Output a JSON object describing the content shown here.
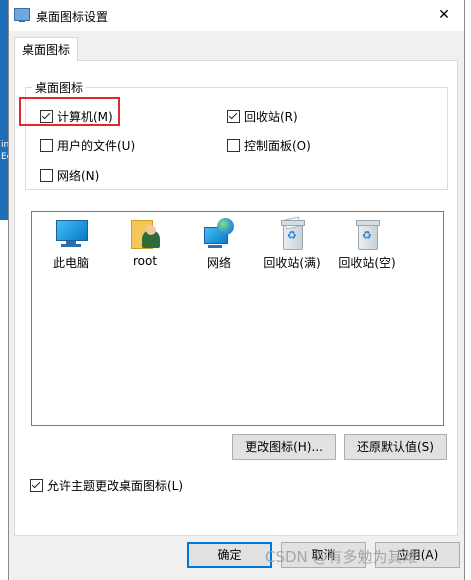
{
  "window": {
    "title": "桌面图标设置",
    "close_glyph": "✕"
  },
  "tabs": [
    {
      "label": "桌面图标"
    }
  ],
  "group": {
    "legend": "桌面图标",
    "checkboxes": [
      {
        "label": "计算机(M)",
        "checked": true
      },
      {
        "label": "回收站(R)",
        "checked": true
      },
      {
        "label": "用户的文件(U)",
        "checked": false
      },
      {
        "label": "控制面板(O)",
        "checked": false
      },
      {
        "label": "网络(N)",
        "checked": false
      }
    ]
  },
  "icons": [
    {
      "label": "此电脑",
      "icon": "this-pc-icon"
    },
    {
      "label": "root",
      "icon": "user-folder-icon"
    },
    {
      "label": "网络",
      "icon": "network-icon"
    },
    {
      "label": "回收站(满)",
      "icon": "recycle-bin-full-icon"
    },
    {
      "label": "回收站(空)",
      "icon": "recycle-bin-empty-icon"
    }
  ],
  "buttons": {
    "change_icon": "更改图标(H)...",
    "restore_default": "还原默认值(S)",
    "ok": "确定",
    "cancel": "取消",
    "apply": "应用(A)"
  },
  "allow_themes": {
    "label": "允许主题更改桌面图标(L)",
    "checked": true
  },
  "watermark": "CSDN @有多勉为其难",
  "desktop_fragments": [
    "ing",
    "Ec"
  ],
  "colors": {
    "highlight": "#e0282e",
    "accent": "#0078d7"
  }
}
